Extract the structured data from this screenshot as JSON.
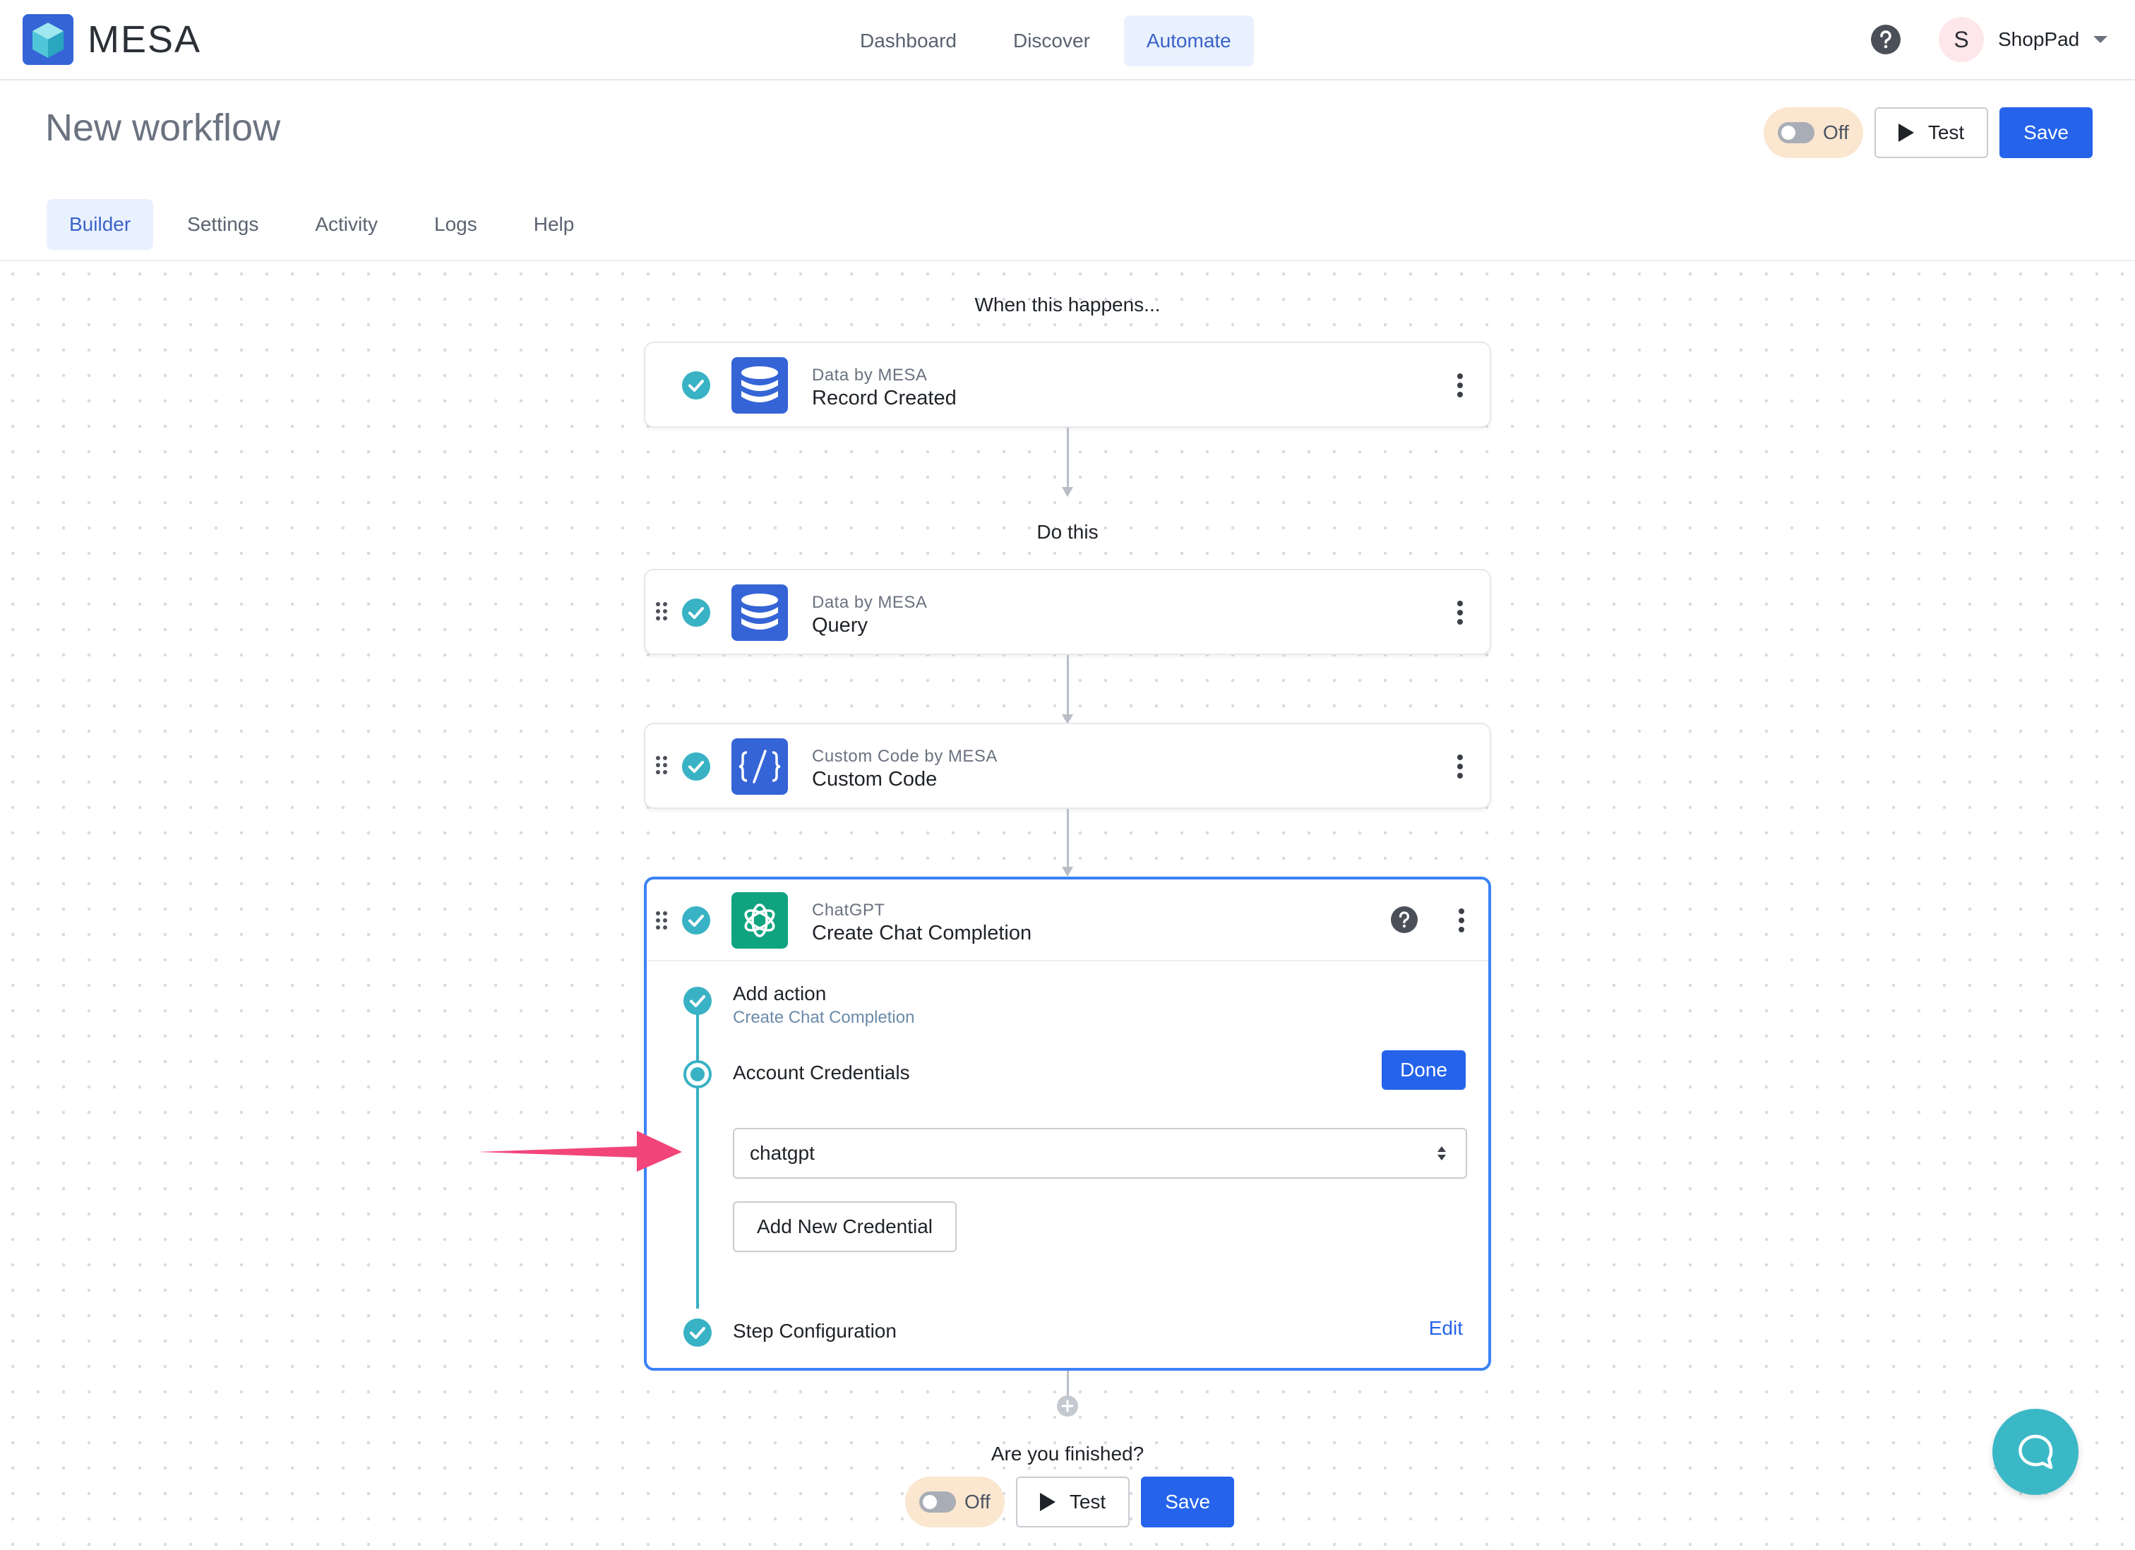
{
  "brand": {
    "name": "MESA"
  },
  "nav": {
    "items": [
      "Dashboard",
      "Discover",
      "Automate"
    ],
    "active": "Automate"
  },
  "user": {
    "initial": "S",
    "name": "ShopPad"
  },
  "page": {
    "title": "New workflow"
  },
  "header_actions": {
    "toggle_label": "Off",
    "test_label": "Test",
    "save_label": "Save"
  },
  "tabs": {
    "items": [
      "Builder",
      "Settings",
      "Activity",
      "Logs",
      "Help"
    ],
    "active": "Builder"
  },
  "workflow": {
    "trigger_label": "When this happens...",
    "action_label": "Do this",
    "steps": [
      {
        "app": "Data by MESA",
        "title": "Record Created",
        "icon": "database-icon"
      },
      {
        "app": "Data by MESA",
        "title": "Query",
        "icon": "database-icon"
      },
      {
        "app": "Custom Code by MESA",
        "title": "Custom Code",
        "icon": "code-icon"
      },
      {
        "app": "ChatGPT",
        "title": "Create Chat Completion",
        "icon": "openai-icon"
      }
    ],
    "expanded": {
      "add_action_title": "Add action",
      "add_action_sub": "Create Chat Completion",
      "credentials_title": "Account Credentials",
      "done_label": "Done",
      "credential_value": "chatgpt",
      "add_credential_label": "Add New Credential",
      "config_title": "Step Configuration",
      "edit_label": "Edit"
    },
    "finished_label": "Are you finished?"
  },
  "footer_actions": {
    "toggle_label": "Off",
    "test_label": "Test",
    "save_label": "Save"
  },
  "colors": {
    "accent": "#2563eb",
    "check": "#38b2c4",
    "toggle_bg": "#fbe6cf",
    "arrow": "#f2457a",
    "chat_fab": "#3bb8c6"
  }
}
